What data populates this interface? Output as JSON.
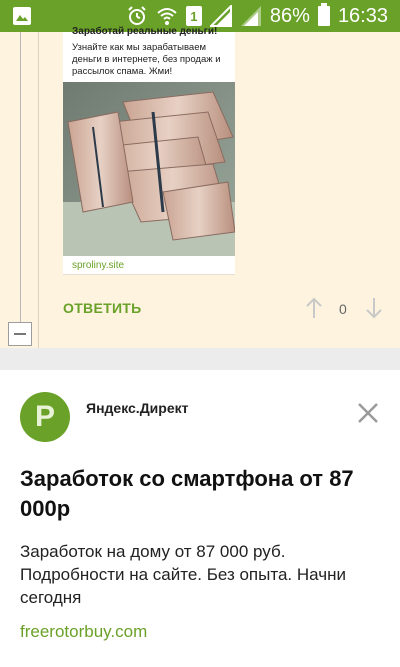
{
  "status_bar": {
    "battery_percent": "86%",
    "time": "16:33",
    "sim_label": "1",
    "icons": [
      "image-icon",
      "alarm-icon",
      "wifi-icon",
      "sim-icon",
      "signal-icon",
      "signal-icon-2",
      "battery-icon"
    ]
  },
  "comment": {
    "ad_preview": {
      "title": "Заработай реальные деньги!",
      "text": "Узнайте как мы зарабатываем деньги в интернете, без продаж и рассылок спама. Жми!",
      "domain": "sproliny.site"
    },
    "reply_label": "ОТВЕТИТЬ",
    "vote_count": "0"
  },
  "ad": {
    "logo_letter": "P",
    "source": "Яндекс.Директ",
    "headline": "Заработок со смартфона от 87 000р",
    "body": "Заработок на дому от 87 000 руб. Подробности на сайте. Без опыта. Начни сегодня",
    "domain": "freerotorbuy.com"
  },
  "colors": {
    "accent": "#6aa128",
    "comment_bg": "#fdf3de",
    "status_bar": "#6aa128"
  }
}
